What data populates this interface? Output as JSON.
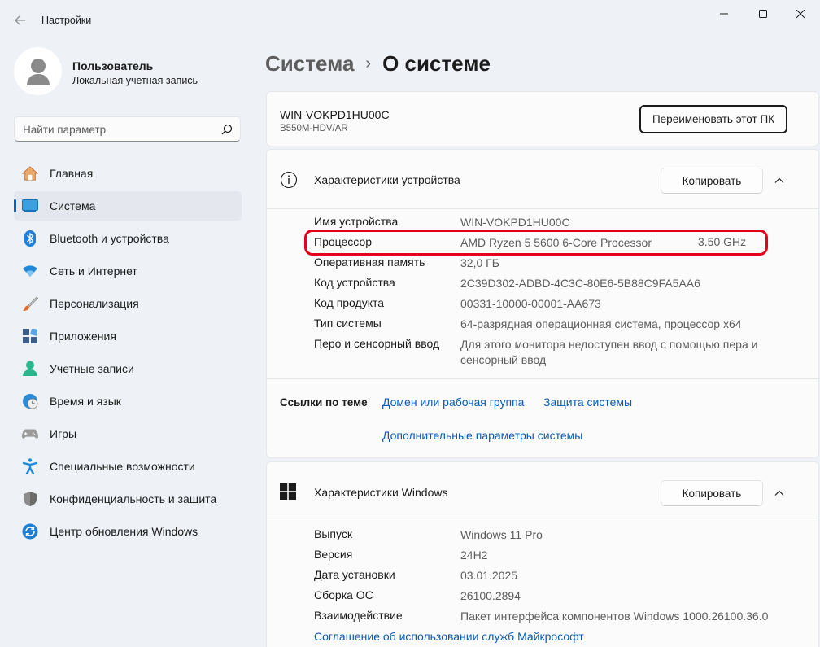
{
  "window": {
    "title": "Настройки"
  },
  "profile": {
    "name": "Пользователь",
    "account_type": "Локальная учетная запись"
  },
  "search": {
    "placeholder": "Найти параметр"
  },
  "nav": {
    "items": [
      {
        "label": "Главная",
        "icon": "home-icon",
        "active": false
      },
      {
        "label": "Система",
        "icon": "system-icon",
        "active": true
      },
      {
        "label": "Bluetooth и устройства",
        "icon": "bluetooth-icon",
        "active": false
      },
      {
        "label": "Сеть и Интернет",
        "icon": "wifi-icon",
        "active": false
      },
      {
        "label": "Персонализация",
        "icon": "brush-icon",
        "active": false
      },
      {
        "label": "Приложения",
        "icon": "apps-icon",
        "active": false
      },
      {
        "label": "Учетные записи",
        "icon": "accounts-icon",
        "active": false
      },
      {
        "label": "Время и язык",
        "icon": "time-language-icon",
        "active": false
      },
      {
        "label": "Игры",
        "icon": "gamepad-icon",
        "active": false
      },
      {
        "label": "Специальные возможности",
        "icon": "accessibility-icon",
        "active": false
      },
      {
        "label": "Конфиденциальность и защита",
        "icon": "shield-icon",
        "active": false
      },
      {
        "label": "Центр обновления Windows",
        "icon": "update-icon",
        "active": false
      }
    ]
  },
  "breadcrumb": {
    "parent": "Система",
    "separator": "›",
    "current": "О системе"
  },
  "pc": {
    "name": "WIN-VOKPD1HU00C",
    "model": "B550M-HDV/AR",
    "rename_label": "Переименовать этот ПК"
  },
  "device_specs": {
    "title": "Характеристики устройства",
    "copy_label": "Копировать",
    "rows": [
      {
        "label": "Имя устройства",
        "value": "WIN-VOKPD1HU00C"
      },
      {
        "label": "Процессор",
        "value": "AMD Ryzen 5 5600 6-Core Processor",
        "extra": "3.50 GHz"
      },
      {
        "label": "Оперативная память",
        "value": "32,0 ГБ"
      },
      {
        "label": "Код устройства",
        "value": "2C39D302-ADBD-4C3C-80E6-5B88C9FA5AA6"
      },
      {
        "label": "Код продукта",
        "value": "00331-10000-00001-AA673"
      },
      {
        "label": "Тип системы",
        "value": "64-разрядная операционная система, процессор x64"
      },
      {
        "label": "Перо и сенсорный ввод",
        "value": "Для этого монитора недоступен ввод с помощью пера и сенсорный ввод"
      }
    ],
    "links_label": "Ссылки по теме",
    "links": [
      "Домен или рабочая группа",
      "Защита системы",
      "Дополнительные параметры системы"
    ]
  },
  "windows_specs": {
    "title": "Характеристики Windows",
    "copy_label": "Копировать",
    "rows": [
      {
        "label": "Выпуск",
        "value": "Windows 11 Pro"
      },
      {
        "label": "Версия",
        "value": "24H2"
      },
      {
        "label": "Дата установки",
        "value": "03.01.2025"
      },
      {
        "label": "Сборка ОС",
        "value": "26100.2894"
      },
      {
        "label": "Взаимодействие",
        "value": "Пакет интерфейса компонентов Windows 1000.26100.36.0"
      }
    ],
    "link": "Соглашение об использовании служб Майкрософт"
  },
  "colors": {
    "accent": "#0067c0",
    "link": "#0a5bb5",
    "highlight": "#e3001b",
    "background": "#eef1f6",
    "card": "#fbfbfb"
  }
}
